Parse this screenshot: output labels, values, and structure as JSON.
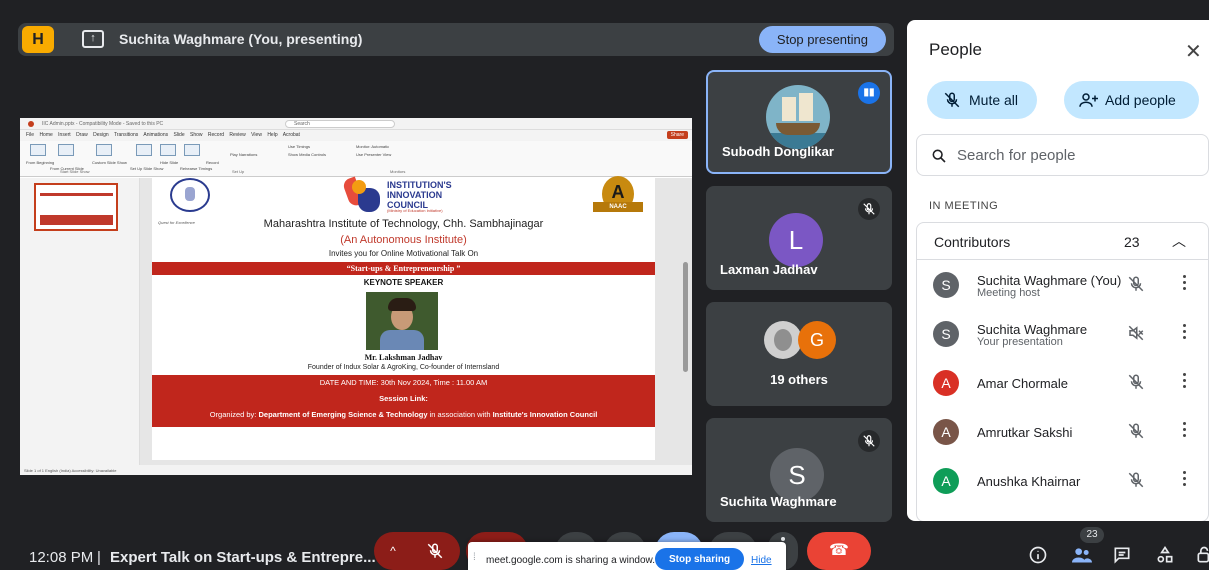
{
  "presenting_bar": {
    "logo_text": "H",
    "title": "Suchita Waghmare (You, presenting)",
    "stop_label": "Stop presenting"
  },
  "shared_screen": {
    "ppt_title": "IIC Admin.pptx - Compatibility Mode - Saved to this PC",
    "search_placeholder": "Search",
    "menu": "File  Home  Insert  Draw  Design  Transitions  Animations  Slide Show  Record  Review  View  Help  Acrobat",
    "share": "Share",
    "ribbon": {
      "from_beginning": "From Beginning",
      "from_current": "From Current Slide",
      "custom": "Custom Slide Show",
      "setup": "Set Up Slide Show",
      "hide": "Hide Slide",
      "rehearse": "Rehearse Timings",
      "record": "Record",
      "narrations": "Play Narrations",
      "use_timings": "Use Timings",
      "media_controls": "Show Media Controls",
      "monitor": "Monitor: Automatic",
      "presenter_view": "Use Presenter View",
      "group_start": "Start Slide Show",
      "group_setup": "Set Up",
      "group_monitors": "Monitors"
    },
    "status": "Slide 1 of 1     English (India)     Accessibility: Unavailable",
    "slide": {
      "seal_motto": "Quest for Excellence",
      "iic_line1": "INSTITUTION'S",
      "iic_line2": "INNOVATION",
      "iic_line3": "COUNCIL",
      "iic_sub": "(Ministry of Education Initiative)",
      "naac_grade": "A",
      "naac_label": "NAAC",
      "institute": "Maharashtra Institute of Technology, Chh. Sambhajinagar",
      "autonomous": "(An Autonomous Institute)",
      "invites": "Invites you  for Online Motivational Talk On",
      "topic": "“Start-ups & Entrepreneurship ”",
      "keynote": "KEYNOTE SPEAKER",
      "speaker": "Mr. Lakshman Jadhav",
      "speaker_role": "Founder of Indux Solar & AgroKing, Co-founder of Internsland",
      "date_time": "DATE AND TIME: 30th Nov 2024, Time : 11.00 AM",
      "session_link": "Session Link:",
      "organized_prefix": "Organized by: ",
      "organized_dept": "Department of Emerging Science & Technology",
      "organized_mid": " in association with ",
      "organized_iic": "Institute's Innovation Council"
    }
  },
  "tiles": [
    {
      "name": "Subodh Donglikar"
    },
    {
      "name": "Laxman Jadhav",
      "initial": "L"
    },
    {
      "name": "19 others",
      "initial": "G"
    },
    {
      "name": "Suchita Waghmare",
      "initial": "S"
    }
  ],
  "people_panel": {
    "title": "People",
    "mute_all": "Mute all",
    "add_people": "Add people",
    "search_placeholder": "Search for people",
    "section": "IN MEETING",
    "contributors_label": "Contributors",
    "contributors_count": "23",
    "participants": [
      {
        "initial": "S",
        "name": "Suchita Waghmare (You)",
        "sub": "Meeting host",
        "color": "#5f6368"
      },
      {
        "initial": "S",
        "name": "Suchita Waghmare",
        "sub": "Your presentation",
        "color": "#5f6368"
      },
      {
        "initial": "A",
        "name": "Amar Chormale",
        "sub": "",
        "color": "#d93025"
      },
      {
        "initial": "A",
        "name": "Amrutkar Sakshi",
        "sub": "",
        "color": "#795548"
      },
      {
        "initial": "A",
        "name": "Anushka Khairnar",
        "sub": "",
        "color": "#0f9d58"
      }
    ]
  },
  "bottom_bar": {
    "time": "12:08 PM",
    "separator": "|",
    "meeting_title": "Expert Talk on Start-ups & Entrepre...",
    "sharing_msg": "meet.google.com is sharing a window.",
    "stop_sharing": "Stop sharing",
    "hide": "Hide",
    "people_badge": "23"
  }
}
